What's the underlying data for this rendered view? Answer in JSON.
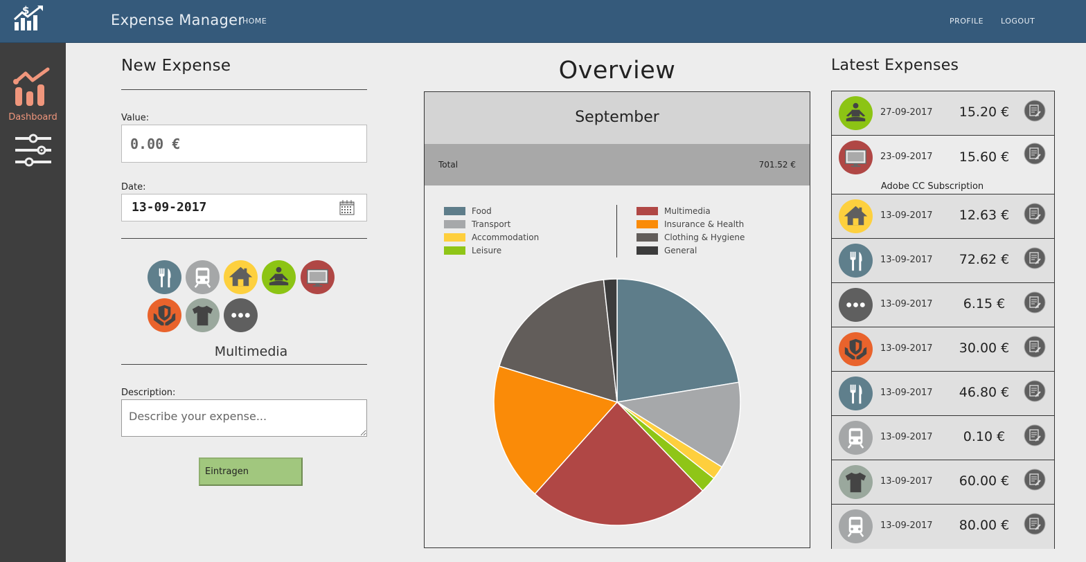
{
  "app": {
    "title": "Expense Manager"
  },
  "nav": {
    "home": "HOME",
    "profile": "PROFILE",
    "logout": "LOGOUT"
  },
  "sidebar": {
    "dashboard_label": "Dashboard"
  },
  "new_expense": {
    "title": "New Expense",
    "value_label": "Value:",
    "value_placeholder": "0.00 €",
    "date_label": "Date:",
    "date_value": "13-09-2017",
    "selected_category": "Multimedia",
    "description_label": "Description:",
    "description_placeholder": "Describe your expense...",
    "submit_label": "Eintragen"
  },
  "categories": [
    {
      "name": "Food",
      "color": "#5f7f8c",
      "icon": "fork-knife-icon"
    },
    {
      "name": "Transport",
      "color": "#a5a7a8",
      "icon": "train-icon"
    },
    {
      "name": "Accommodation",
      "color": "#fdd03e",
      "icon": "house-icon"
    },
    {
      "name": "Leisure",
      "color": "#8cc414",
      "icon": "meditation-icon"
    },
    {
      "name": "Multimedia",
      "color": "#b04745",
      "icon": "monitor-icon"
    },
    {
      "name": "Insurance & Health",
      "color": "#e9632c",
      "icon": "shield-hands-icon"
    },
    {
      "name": "Clothing & Hygiene",
      "color": "#9aa89d",
      "icon": "tshirt-icon"
    },
    {
      "name": "General",
      "color": "#5f5f5f",
      "icon": "ellipsis-icon"
    }
  ],
  "overview": {
    "title": "Overview",
    "month": "September",
    "total_label": "Total",
    "total_value": "701.52 €"
  },
  "chart_data": {
    "type": "pie",
    "title": "",
    "series": [
      {
        "name": "Food",
        "value": 157.3,
        "color": "#5e7d8a"
      },
      {
        "name": "Transport",
        "value": 80.0,
        "color": "#a6a8aa"
      },
      {
        "name": "Accommodation",
        "value": 12.63,
        "color": "#fecf3d"
      },
      {
        "name": "Leisure",
        "value": 15.2,
        "color": "#8fc517"
      },
      {
        "name": "Multimedia",
        "value": 167.1,
        "color": "#b04745"
      },
      {
        "name": "Insurance & Health",
        "value": 127.0,
        "color": "#fa8b08"
      },
      {
        "name": "Clothing & Hygiene",
        "value": 130.0,
        "color": "#625d5a"
      },
      {
        "name": "General",
        "value": 12.29,
        "color": "#3c3c3c"
      }
    ],
    "legend_position": "top"
  },
  "latest": {
    "title": "Latest Expenses",
    "items": [
      {
        "date": "27-09-2017",
        "amount": "15.20 €",
        "icon": "meditation-icon",
        "color": "#8cc414",
        "description": ""
      },
      {
        "date": "23-09-2017",
        "amount": "15.60 €",
        "icon": "monitor-icon",
        "color": "#b04745",
        "description": "Adobe CC Subscription"
      },
      {
        "date": "13-09-2017",
        "amount": "12.63 €",
        "icon": "house-icon",
        "color": "#fdd03e",
        "description": ""
      },
      {
        "date": "13-09-2017",
        "amount": "72.62 €",
        "icon": "fork-knife-icon",
        "color": "#5f7f8c",
        "description": ""
      },
      {
        "date": "13-09-2017",
        "amount": "6.15 €",
        "icon": "ellipsis-icon",
        "color": "#5f5f5f",
        "description": ""
      },
      {
        "date": "13-09-2017",
        "amount": "30.00 €",
        "icon": "shield-hands-icon",
        "color": "#e9632c",
        "description": ""
      },
      {
        "date": "13-09-2017",
        "amount": "46.80 €",
        "icon": "fork-knife-icon",
        "color": "#5f7f8c",
        "description": ""
      },
      {
        "date": "13-09-2017",
        "amount": "0.10 €",
        "icon": "train-icon",
        "color": "#a5a7a8",
        "description": ""
      },
      {
        "date": "13-09-2017",
        "amount": "60.00 €",
        "icon": "tshirt-icon",
        "color": "#9aa89d",
        "description": ""
      },
      {
        "date": "13-09-2017",
        "amount": "80.00 €",
        "icon": "train-icon",
        "color": "#a5a7a8",
        "description": ""
      }
    ]
  }
}
